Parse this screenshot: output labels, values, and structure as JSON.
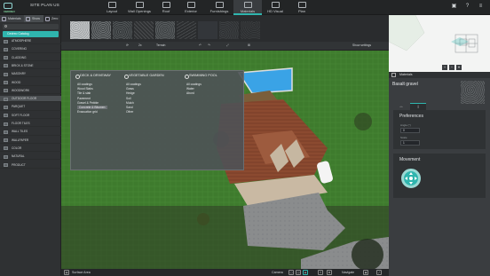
{
  "app": {
    "logo_text": "CEDREO",
    "site_title": "SITE PLAN US"
  },
  "topbar": {
    "items": [
      {
        "label": "Layout",
        "icon": "layout-icon"
      },
      {
        "label": "Wall Openings",
        "icon": "door-icon"
      },
      {
        "label": "Roof",
        "icon": "roof-icon"
      },
      {
        "label": "Exterior",
        "icon": "exterior-icon"
      },
      {
        "label": "Furnishings",
        "icon": "sofa-icon"
      },
      {
        "label": "Materials",
        "icon": "brush-icon"
      },
      {
        "label": "HD Visual",
        "icon": "camera-icon"
      },
      {
        "label": "Plan",
        "icon": "plan-icon"
      }
    ],
    "active": "Materials",
    "right_icons": [
      "save-icon",
      "help-icon",
      "menu-icon"
    ],
    "right_glyphs": [
      "▣",
      "?",
      "≡"
    ]
  },
  "leftpanel": {
    "tabs": [
      {
        "label": "Materials"
      },
      {
        "label": "Show"
      },
      {
        "label": "Zero"
      }
    ],
    "search_placeholder": "",
    "catalog_button": "Cedreo Catalog",
    "categories": [
      "ATMOSPHERE",
      "COVERING",
      "CLADDING",
      "BRICK & STONE",
      "MASONRY",
      "WOOD",
      "WOODWORK",
      "OUTDOOR FLOOR",
      "PARQUET",
      "SOFT FLOOR",
      "FLOOR TILES",
      "WALL TILES",
      "WALLPAPER",
      "COLOR",
      "NATURAL",
      "PRODUCT"
    ],
    "selected_category": "OUTDOOR FLOOR"
  },
  "texture_toolbar": {
    "rotate": "⟳",
    "zoom": "2x",
    "terrain_label": "Terrain",
    "show_settings": "Show settings"
  },
  "dropdown": {
    "columns": [
      {
        "title": "DECK & DRIVEWAY",
        "options": [
          "All coatings",
          "Wood Slabs",
          "Tile & slab",
          "Pavement",
          "Gravel & Pebble",
          "Concrete & Bitumen",
          "Evacuation grid"
        ],
        "selected": "Concrete & Bitumen"
      },
      {
        "title": "VEGETABLE GARDEN",
        "options": [
          "All coatings",
          "Grass",
          "Hedge",
          "Soil",
          "Mulch",
          "Sand",
          "Other"
        ],
        "selected": ""
      },
      {
        "title": "SWIMMING POOL",
        "options": [
          "All coatings",
          "Water",
          "Abord"
        ],
        "selected": ""
      }
    ]
  },
  "bottombar": {
    "surface_area": "Surface Area",
    "camera": "Camera",
    "navigate": "Navigate"
  },
  "rightpanel": {
    "header": "Materials",
    "material_name": "Basalt gravel",
    "tabs": [
      "↔",
      "i"
    ],
    "preferences_title": "Preferences",
    "fields": [
      {
        "label": "Angle (°)",
        "value": "0"
      },
      {
        "label": "Scale",
        "value": "1"
      }
    ],
    "movement_title": "Movement"
  },
  "colors": {
    "accent": "#2fb5ae",
    "panel": "#2f3133",
    "grass": "#3d7a2c"
  }
}
